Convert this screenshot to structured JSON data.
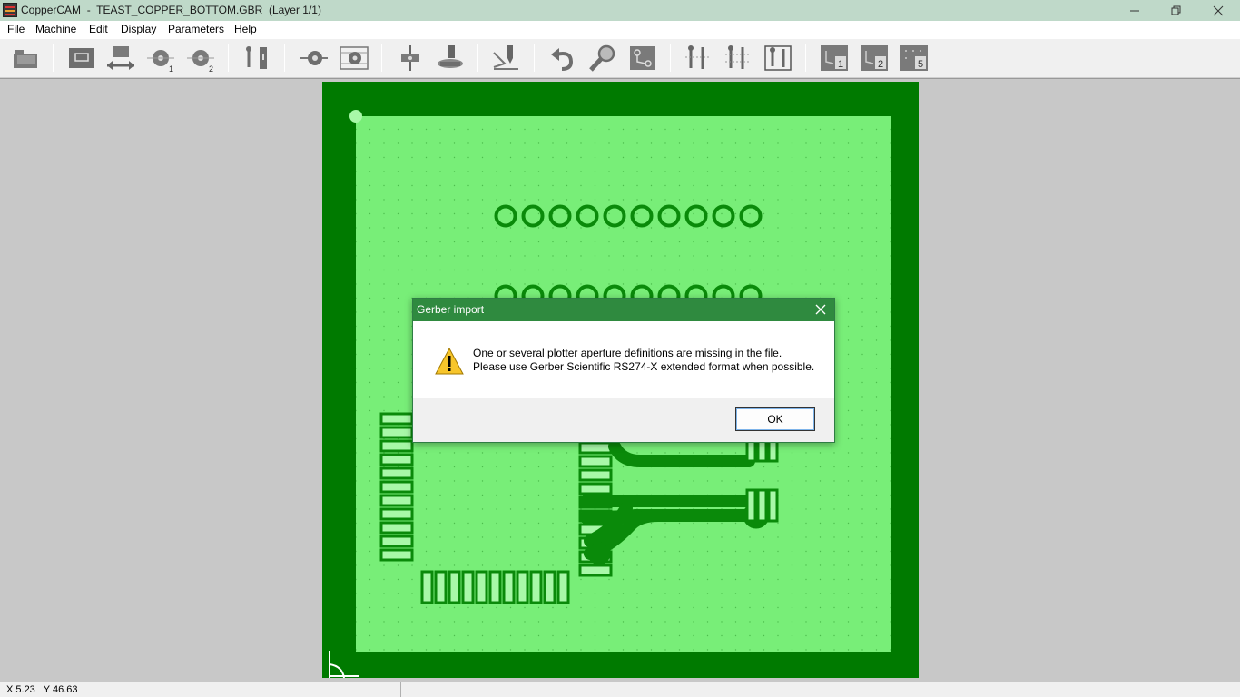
{
  "window": {
    "title": "CopperCAM  -  TEAST_COPPER_BOTTOM.GBR  (Layer 1/1)",
    "minimize_icon": "minimize-icon",
    "restore_icon": "restore-icon",
    "close_icon": "close-icon"
  },
  "menu": {
    "items": [
      "File",
      "Machine",
      "Edit",
      "Display",
      "Parameters",
      "Help"
    ]
  },
  "toolbar": {
    "icons": [
      "open-file-icon",
      "board-outline-icon",
      "resize-board-icon",
      "drill-1-icon",
      "drill-2-icon",
      "track-icon",
      "pad-icon",
      "pad-contour-icon",
      "spot-drill-icon",
      "mill-tool-icon",
      "engrave-icon",
      "undo-icon",
      "zoom-icon",
      "hatch-icon",
      "contour-1-icon",
      "contour-2-icon",
      "contour-3-icon",
      "layer-1-icon",
      "layer-2-icon",
      "layer-5-icon"
    ],
    "badges": {
      "drill1": "1",
      "drill2": "2",
      "layer1": "1",
      "layer2": "2",
      "layer5": "5"
    }
  },
  "colors": {
    "board_dark": "#007a00",
    "board_light": "#78ee78",
    "workspace": "#c8c8c8",
    "dialog_title": "#2f8a3f"
  },
  "status": {
    "coords": "X 5.23   Y 46.63"
  },
  "dialog": {
    "title": "Gerber import",
    "message_line1": "One or several plotter aperture definitions are missing in the file.",
    "message_line2": "Please use Gerber Scientific RS274-X extended format when possible.",
    "ok_label": "OK",
    "icon": "warning-icon"
  }
}
